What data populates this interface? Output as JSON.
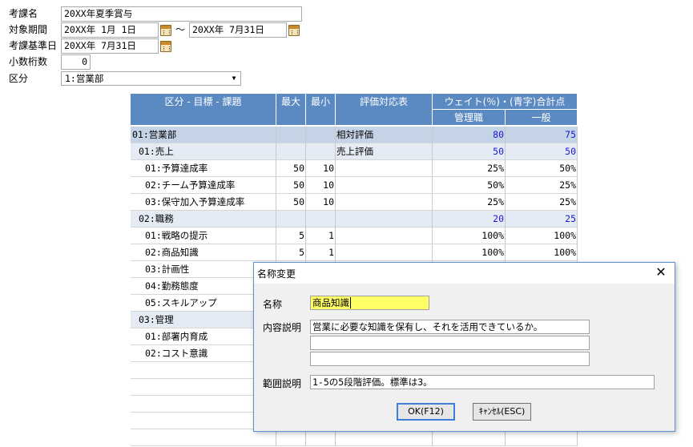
{
  "form": {
    "course_label": "考課名",
    "course_value": "20XX年夏季賞与",
    "period_label": "対象期間",
    "period_from": "20XX年  1月  1日",
    "period_sep": "～",
    "period_to": "20XX年  7月31日",
    "basedate_label": "考課基準日",
    "basedate_value": "20XX年  7月31日",
    "decimals_label": "小数桁数",
    "decimals_value": "0",
    "division_label": "区分",
    "division_value": "1:営業部"
  },
  "grid": {
    "headers": {
      "name": "区分 - 目標 - 課題",
      "max": "最大",
      "min": "最小",
      "table": "評価対応表",
      "weight": "ウェイト(％)・(青字)合計点",
      "mgmt": "管理職",
      "general": "一般"
    },
    "rows": [
      {
        "level": 1,
        "name": "01:営業部",
        "max": "",
        "min": "",
        "table": "相対評価",
        "mgmt": "80",
        "general": "75",
        "blue": true
      },
      {
        "level": 2,
        "name": "01:売上",
        "max": "",
        "min": "",
        "table": "売上評価",
        "mgmt": "50",
        "general": "50",
        "blue": true
      },
      {
        "level": 3,
        "name": "01:予算達成率",
        "max": "50",
        "min": "10",
        "table": "",
        "mgmt": "25%",
        "general": "50%",
        "blue": false
      },
      {
        "level": 3,
        "name": "02:チーム予算達成率",
        "max": "50",
        "min": "10",
        "table": "",
        "mgmt": "50%",
        "general": "25%",
        "blue": false
      },
      {
        "level": 3,
        "name": "03:保守加入予算達成率",
        "max": "50",
        "min": "10",
        "table": "",
        "mgmt": "25%",
        "general": "25%",
        "blue": false
      },
      {
        "level": 2,
        "name": "02:職務",
        "max": "",
        "min": "",
        "table": "",
        "mgmt": "20",
        "general": "25",
        "blue": true
      },
      {
        "level": 3,
        "name": "01:戦略の提示",
        "max": "5",
        "min": "1",
        "table": "",
        "mgmt": "100%",
        "general": "100%",
        "blue": false
      },
      {
        "level": 3,
        "name": "02:商品知識",
        "max": "5",
        "min": "1",
        "table": "",
        "mgmt": "100%",
        "general": "100%",
        "blue": false
      },
      {
        "level": 3,
        "name": "03:計画性",
        "max": "",
        "min": "",
        "table": "",
        "mgmt": "",
        "general": "",
        "blue": false
      },
      {
        "level": 3,
        "name": "04:勤務態度",
        "max": "",
        "min": "",
        "table": "",
        "mgmt": "",
        "general": "",
        "blue": false
      },
      {
        "level": 3,
        "name": "05:スキルアップ",
        "max": "",
        "min": "",
        "table": "",
        "mgmt": "",
        "general": "",
        "blue": false
      },
      {
        "level": 2,
        "name": "03:管理",
        "max": "",
        "min": "",
        "table": "",
        "mgmt": "",
        "general": "",
        "blue": false
      },
      {
        "level": 3,
        "name": "01:部署内育成",
        "max": "",
        "min": "",
        "table": "",
        "mgmt": "",
        "general": "",
        "blue": false
      },
      {
        "level": 3,
        "name": "02:コスト意識",
        "max": "",
        "min": "",
        "table": "",
        "mgmt": "",
        "general": "",
        "blue": false
      },
      {
        "level": 0,
        "name": "",
        "max": "",
        "min": "",
        "table": "",
        "mgmt": "",
        "general": "",
        "blue": false
      },
      {
        "level": 0,
        "name": "",
        "max": "",
        "min": "",
        "table": "",
        "mgmt": "",
        "general": "",
        "blue": false
      },
      {
        "level": 0,
        "name": "",
        "max": "",
        "min": "",
        "table": "",
        "mgmt": "",
        "general": "",
        "blue": false
      },
      {
        "level": 0,
        "name": "",
        "max": "",
        "min": "",
        "table": "",
        "mgmt": "",
        "general": "",
        "blue": false
      },
      {
        "level": 0,
        "name": "",
        "max": "",
        "min": "",
        "table": "",
        "mgmt": "",
        "general": "",
        "blue": false
      }
    ]
  },
  "dialog": {
    "title": "名称変更",
    "close_icon": "close-icon",
    "name_label": "名称",
    "name_value": "商品知識",
    "desc_label": "内容説明",
    "desc_line1": "営業に必要な知識を保有し、それを活用できているか。",
    "desc_line2": "",
    "desc_line3": "",
    "range_label": "範囲説明",
    "range_value": "1-5の5段階評価。標準は3。",
    "ok_label": "OK(F12)",
    "cancel_label": "ｷｬﾝｾﾙ(ESC)"
  },
  "colors": {
    "header_bg": "#5b8ac2",
    "level1_bg": "#c4d3e6",
    "level2_bg": "#e4ebf5",
    "total_text": "#1a1ad6",
    "name_highlight": "#ffff66"
  }
}
